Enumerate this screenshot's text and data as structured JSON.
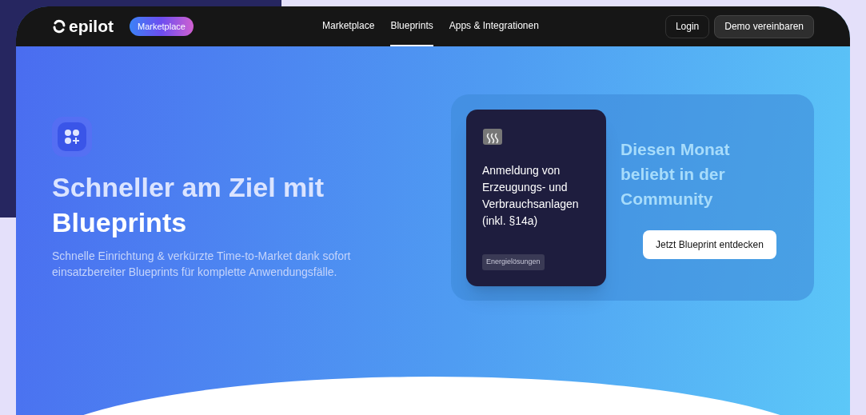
{
  "header": {
    "logo": "epilot",
    "badge": "Marketplace",
    "nav": [
      {
        "label": "Marketplace",
        "selected": false
      },
      {
        "label": "Blueprints",
        "selected": true
      },
      {
        "label": "Apps & Integrationen",
        "selected": false
      }
    ],
    "buttons": [
      {
        "label": "Login",
        "kind": "outline"
      },
      {
        "label": "Demo vereinbaren",
        "kind": "filled"
      }
    ]
  },
  "hero": {
    "title_line_1": "Schneller am Ziel mit",
    "title_line_2": "Blueprints",
    "subtitle": "Schnelle Einrichtung & verkürzte Time-to-Market dank sofort einsatzbereiter Blueprints für komplette Anwendungsfälle."
  },
  "featured": {
    "card": {
      "title": "Anmeldung von Erzeugungs- und Verbrauchsanlagen (inkl. §14a)",
      "tag": "Energielösungen"
    },
    "heading": "Diesen Monat beliebt in der Community",
    "button": "Jetzt Blueprint entdecken"
  }
}
